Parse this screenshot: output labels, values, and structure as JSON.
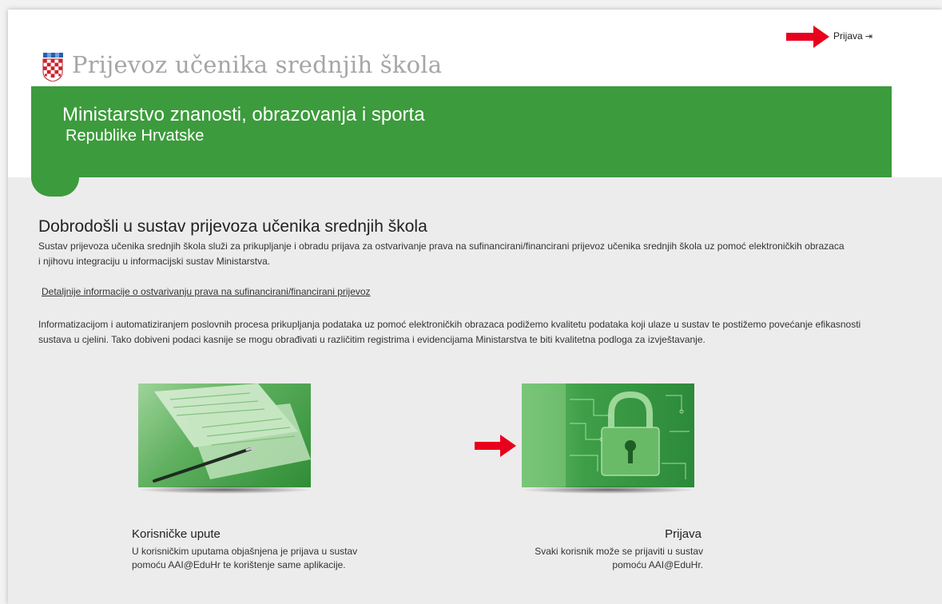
{
  "header": {
    "login_label": "Prijava",
    "login_icon": "sign-in-icon",
    "site_title": "Prijevoz učenika srednjih škola"
  },
  "banner": {
    "line1": "Ministarstvo znanosti, obrazovanja i sporta",
    "line2": "Republike Hrvatske"
  },
  "main": {
    "title": "Dobrodošli u sustav prijevoza učenika srednjih škola",
    "intro": "Sustav prijevoza učenika srednjih škola služi za prikupljanje i obradu prijava za ostvarivanje prava na sufinancirani/financirani prijevoz učenika srednjih škola uz pomoć elektroničkih obrazaca i njihovu integraciju u informacijski sustav Ministarstva.",
    "details_link": "Detaljnije informacije o ostvarivanju prava na sufinancirani/financirani prijevoz",
    "info": "Informatizacijom i automatiziranjem poslovnih procesa prikupljanja podataka uz pomoć elektroničkih obrazaca podižemo kvalitetu podataka koji ulaze u sustav te postižemo povećanje efikasnosti sustava u cjelini. Tako dobiveni podaci kasnije se mogu obrađivati u različitim registrima i evidencijama Ministarstva te biti kvalitetna podloga za izvještavanje."
  },
  "cards": [
    {
      "title": "Korisničke upute",
      "text": "U korisničkim uputama objašnjena je prijava u sustav pomoću AAI@EduHr te korištenje same aplikacije."
    },
    {
      "title": "Prijava",
      "text": "Svaki korisnik može se prijaviti u sustav pomoću AAI@EduHr."
    }
  ],
  "colors": {
    "brand_green": "#3c9b3c",
    "annotation_arrow": "#e8001c",
    "title_gray": "#a6a6a6"
  }
}
